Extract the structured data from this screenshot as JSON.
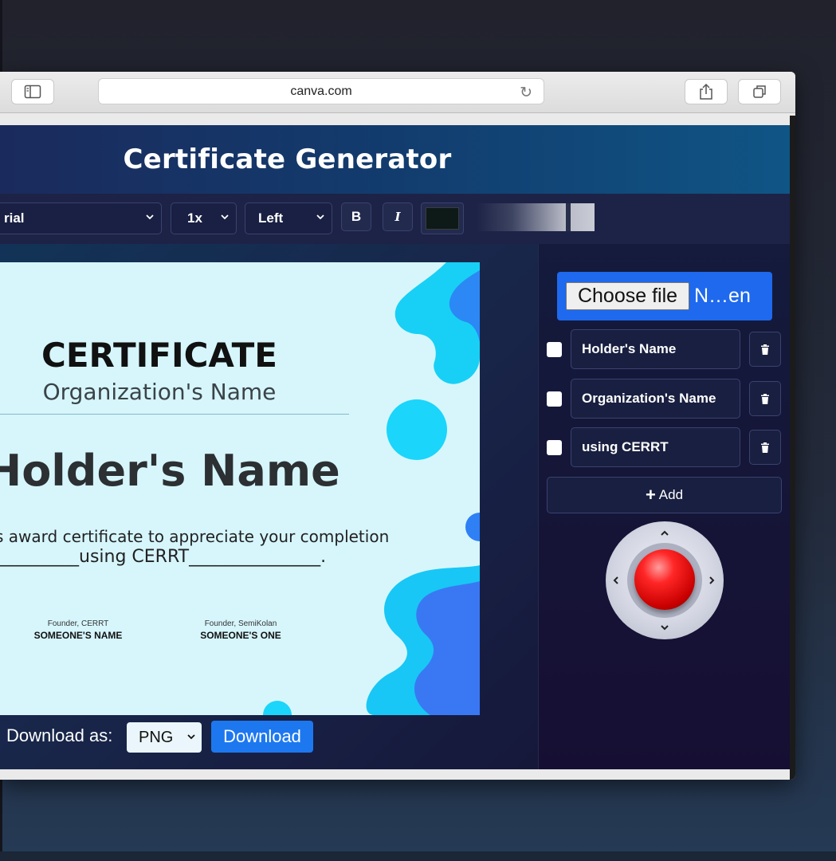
{
  "browser": {
    "url": "canva.com"
  },
  "app": {
    "title": "Certificate Generator"
  },
  "format_toolbar": {
    "font_family": "rial",
    "size": "1x",
    "align": "Left",
    "bold_label": "B",
    "italic_label": "I",
    "text_color": "#0d1a17"
  },
  "certificate": {
    "title": "CERTIFICATE",
    "organization": "Organization's Name",
    "holder": "Holder's Name",
    "text": "s award certificate to appreciate your completion",
    "line": "_________using CERRT_______________.",
    "signatures": [
      {
        "role": "Founder, CERRT",
        "name": "SOMEONE'S NAME"
      },
      {
        "role": "Founder, SemiKolan",
        "name": "SOMEONE'S ONE"
      }
    ],
    "colors": {
      "background": "#d6f6fc",
      "blob_light": "#18d0f5",
      "blob_dark": "#2f7ff5"
    }
  },
  "download": {
    "label": "Download as:",
    "format": "PNG",
    "button": "Download"
  },
  "panel": {
    "choose_file": "Choose file",
    "file_name": "N…en",
    "fields": [
      {
        "value": "Holder's Name"
      },
      {
        "value": "Organization's Name"
      },
      {
        "value": "using CERRT"
      }
    ],
    "add_label": "Add"
  },
  "icons": [
    "sidebar-icon",
    "reload-icon",
    "share-icon",
    "tabs-icon",
    "chevron-down-icon",
    "trash-icon",
    "plus-icon",
    "joystick-arrow-icon"
  ],
  "accent_color": "#1e69ee"
}
